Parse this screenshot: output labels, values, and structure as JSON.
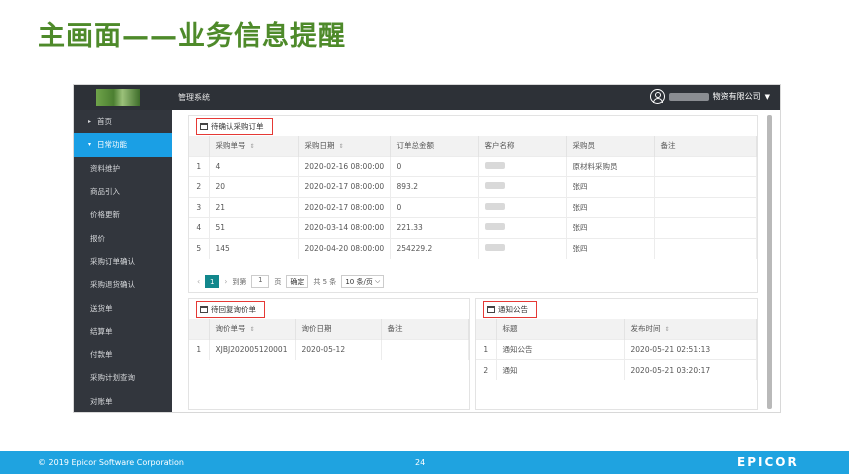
{
  "slide_title": "主画面——业务信息提醒",
  "topbar": {
    "system_name": "管理系统",
    "company_suffix": "物资有限公司"
  },
  "sidebar": {
    "items": [
      {
        "label": "首页",
        "arrow": "▸"
      },
      {
        "label": "日常功能",
        "arrow": "▾"
      },
      {
        "label": "资料维护"
      },
      {
        "label": "商品引入"
      },
      {
        "label": "价格更新"
      },
      {
        "label": "报价"
      },
      {
        "label": "采购订单确认"
      },
      {
        "label": "采购退货确认"
      },
      {
        "label": "送货单"
      },
      {
        "label": "结算单"
      },
      {
        "label": "付款单"
      },
      {
        "label": "采购计划查询"
      },
      {
        "label": "对账单"
      }
    ]
  },
  "po_panel": {
    "title": "待确认采购订单",
    "columns": [
      "采购单号",
      "采购日期",
      "订单总金额",
      "客户名称",
      "采购员",
      "备注"
    ],
    "rows": [
      {
        "idx": "1",
        "no": "4",
        "date": "2020-02-16 08:00:00",
        "amount": "0",
        "buyer": "原材料采购员",
        "remark": ""
      },
      {
        "idx": "2",
        "no": "20",
        "date": "2020-02-17 08:00:00",
        "amount": "893.2",
        "buyer": "张四",
        "remark": ""
      },
      {
        "idx": "3",
        "no": "21",
        "date": "2020-02-17 08:00:00",
        "amount": "0",
        "buyer": "张四",
        "remark": ""
      },
      {
        "idx": "4",
        "no": "51",
        "date": "2020-03-14 08:00:00",
        "amount": "221.33",
        "buyer": "张四",
        "remark": ""
      },
      {
        "idx": "5",
        "no": "145",
        "date": "2020-04-20 08:00:00",
        "amount": "254229.2",
        "buyer": "张四",
        "remark": ""
      }
    ],
    "pager": {
      "current": "1",
      "goto_label": "到第",
      "goto_value": "1",
      "page_unit": "页",
      "confirm": "确定",
      "total": "共 5 条",
      "page_size": "10 条/页"
    }
  },
  "quote_panel": {
    "title": "待回复询价单",
    "columns": [
      "询价单号",
      "询价日期",
      "备注"
    ],
    "rows": [
      {
        "idx": "1",
        "no": "XJBJ202005120001",
        "date": "2020-05-12",
        "remark": ""
      }
    ]
  },
  "notice_panel": {
    "title": "通知公告",
    "columns": [
      "标题",
      "发布时间"
    ],
    "rows": [
      {
        "idx": "1",
        "title": "通知公告",
        "time": "2020-05-21 02:51:13"
      },
      {
        "idx": "2",
        "title": "通知",
        "time": "2020-05-21 03:20:17"
      }
    ]
  },
  "footer": {
    "copyright": "© 2019 Epicor Software Corporation",
    "page_number": "24",
    "brand": "EPICOR"
  }
}
